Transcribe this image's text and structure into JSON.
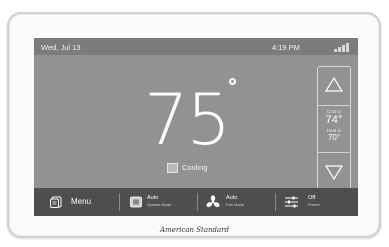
{
  "statusbar": {
    "date": "Wed, Jul 13",
    "time": "4:19 PM",
    "signal_icon": "signal-strength-icon"
  },
  "main": {
    "current_temp": "75",
    "status_label": "Cooling"
  },
  "setpoints": {
    "cool_label": "Cool to",
    "cool_value": "74°",
    "heat_label": "Heat to",
    "heat_value": "70°"
  },
  "bottom": {
    "menu_label": "Menu",
    "system_mode_value": "Auto",
    "system_mode_label": "System Mode",
    "fan_mode_value": "Auto",
    "fan_mode_label": "Fan Mode",
    "preset_value": "Off",
    "preset_label": "Preset"
  },
  "brand": "American Standard",
  "colors": {
    "screen_bg": "#929292",
    "bottom_bar": "#4e4e4e",
    "text": "#ffffff"
  }
}
